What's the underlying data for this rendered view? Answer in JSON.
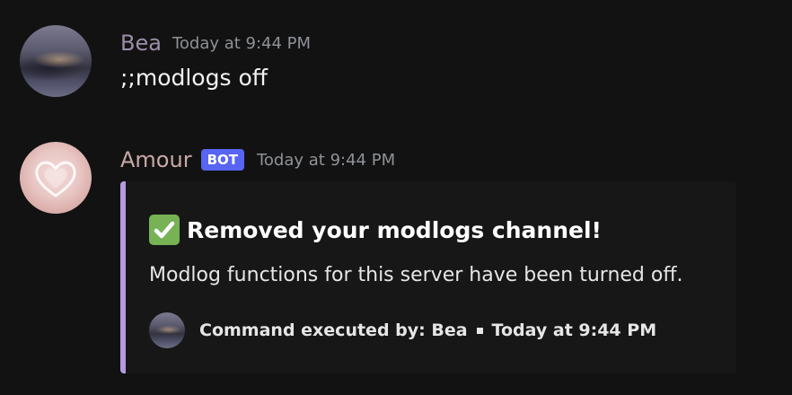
{
  "messages": [
    {
      "author": "Bea",
      "timestamp": "Today at 9:44 PM",
      "content": ";;modlogs off"
    },
    {
      "author": "Amour",
      "badge": "BOT",
      "timestamp": "Today at 9:44 PM",
      "embed": {
        "accent_color": "#b39be0",
        "title_icon": "white-check-mark-icon",
        "title": "Removed your modlogs channel!",
        "description": "Modlog functions for this server have been turned off.",
        "footer": {
          "text": "Command executed by: Bea",
          "timestamp": "Today at 9:44 PM"
        }
      }
    }
  ],
  "colors": {
    "background": "#121212",
    "bot_badge": "#5865f2",
    "check_icon": "#77b255"
  }
}
